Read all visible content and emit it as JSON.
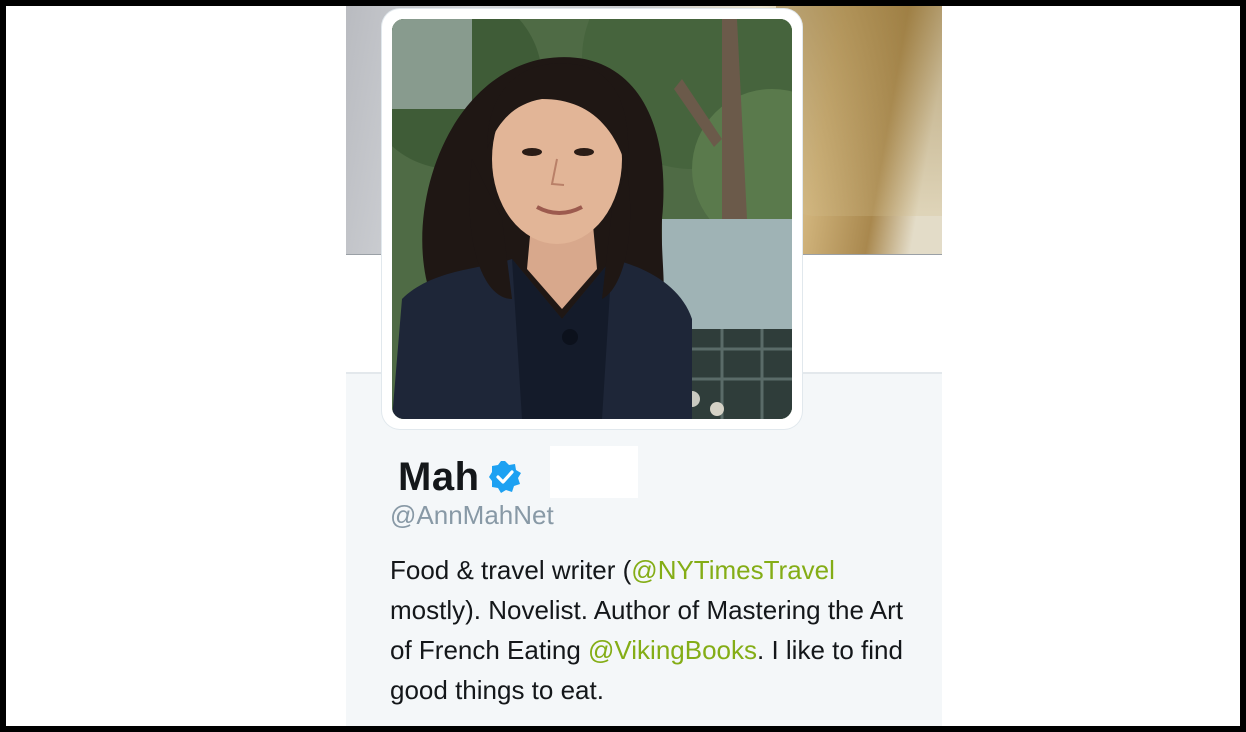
{
  "profile": {
    "display_name": "Mah",
    "verified_icon": "verified-badge-icon",
    "handle": "@AnnMahNet",
    "bio": {
      "part1": "Food & travel writer (",
      "mention1": "@NYTimesTravel",
      "part2": " mostly). Novelist. Author of Mastering the Art of French Eating ",
      "mention2": "@VikingBooks",
      "part3": ". I like to find good things to eat."
    }
  },
  "colors": {
    "link": "#84ad16",
    "verified": "#1da1f2",
    "handle": "#8899a6",
    "panel_bg": "#f4f7f9"
  }
}
